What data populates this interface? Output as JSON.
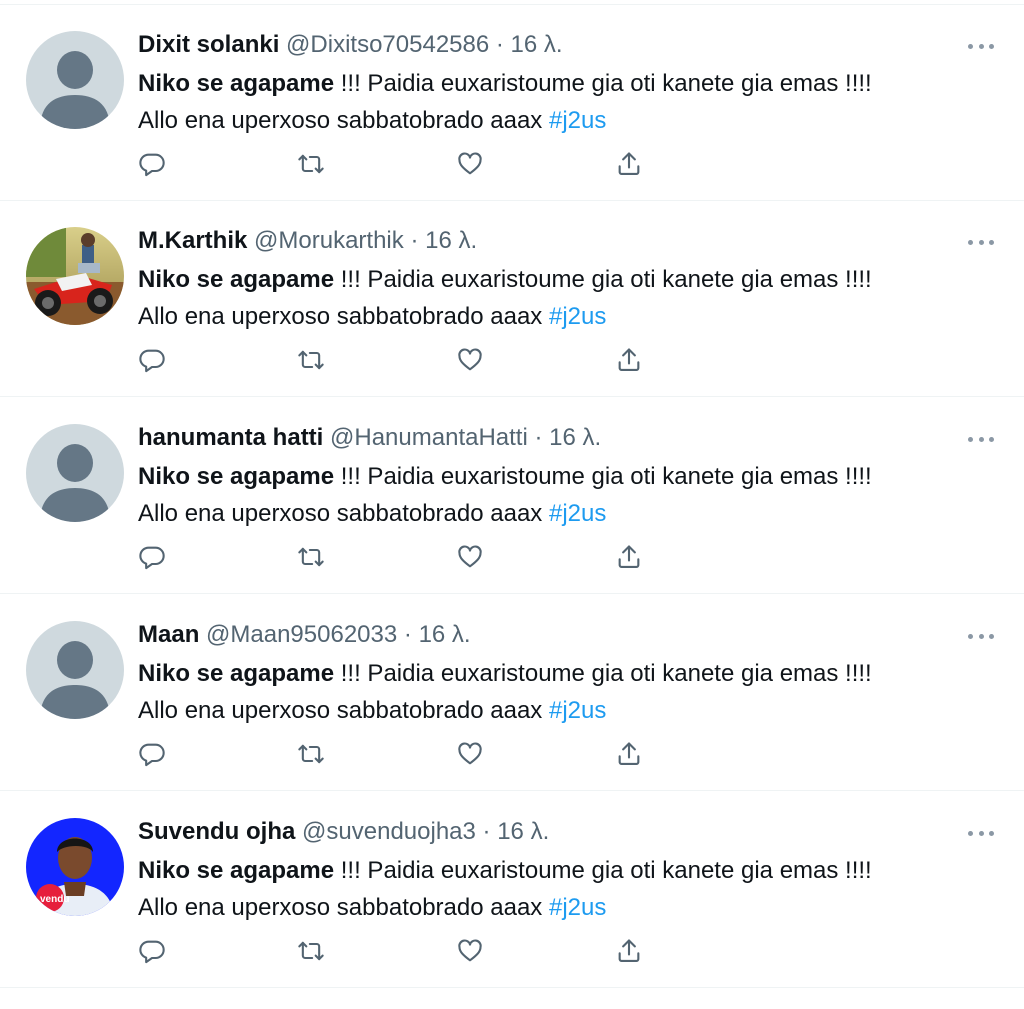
{
  "tweets": [
    {
      "display_name": "Dixit solanki",
      "handle": "@Dixitso70542586",
      "separator": "·",
      "time": "16 λ.",
      "text_bold": "Niko se agapame",
      "text_rest": " !!! Paidia euxaristoume gia oti kanete gia emas !!!!",
      "line2": "Allo ena uperxoso sabbatobrado aaax ",
      "hashtag": "#j2us",
      "avatar": "default-avatar-icon"
    },
    {
      "display_name": "M.Karthik",
      "handle": "@Morukarthik",
      "separator": "·",
      "time": "16 λ.",
      "text_bold": "Niko se agapame",
      "text_rest": " !!! Paidia euxaristoume gia oti kanete gia emas !!!!",
      "line2": "Allo ena uperxoso sabbatobrado aaax ",
      "hashtag": "#j2us",
      "avatar": "motorcycle-photo"
    },
    {
      "display_name": "hanumanta hatti",
      "handle": "@HanumantaHatti",
      "separator": "·",
      "time": "16 λ.",
      "text_bold": "Niko se agapame",
      "text_rest": " !!! Paidia euxaristoume gia oti kanete gia emas !!!!",
      "line2": "Allo ena uperxoso sabbatobrado aaax ",
      "hashtag": "#j2us",
      "avatar": "default-avatar-icon"
    },
    {
      "display_name": "Maan",
      "handle": "@Maan95062033",
      "separator": "·",
      "time": "16 λ.",
      "text_bold": "Niko se agapame",
      "text_rest": " !!! Paidia euxaristoume gia oti kanete gia emas !!!!",
      "line2": "Allo ena uperxoso sabbatobrado aaax ",
      "hashtag": "#j2us",
      "avatar": "default-avatar-icon"
    },
    {
      "display_name": "Suvendu ojha",
      "handle": "@suvenduojha3",
      "separator": "·",
      "time": "16 λ.",
      "text_bold": "Niko se agapame",
      "text_rest": " !!! Paidia euxaristoume gia oti kanete gia emas !!!!",
      "line2": "Allo ena uperxoso sabbatobrado aaax ",
      "hashtag": "#j2us",
      "avatar": "portrait-photo",
      "avatar_text": "vendu"
    }
  ],
  "icons": {
    "reply": "reply-icon",
    "retweet": "retweet-icon",
    "like": "like-icon",
    "share": "share-icon",
    "more": "more-icon"
  },
  "colors": {
    "text": "#0f1419",
    "secondary": "#536471",
    "hashtag": "#1d9bf0",
    "divider": "#eff3f4",
    "icon": "#536471",
    "default_avatar_bg": "#cfd9de",
    "default_avatar_fg": "#657786"
  }
}
